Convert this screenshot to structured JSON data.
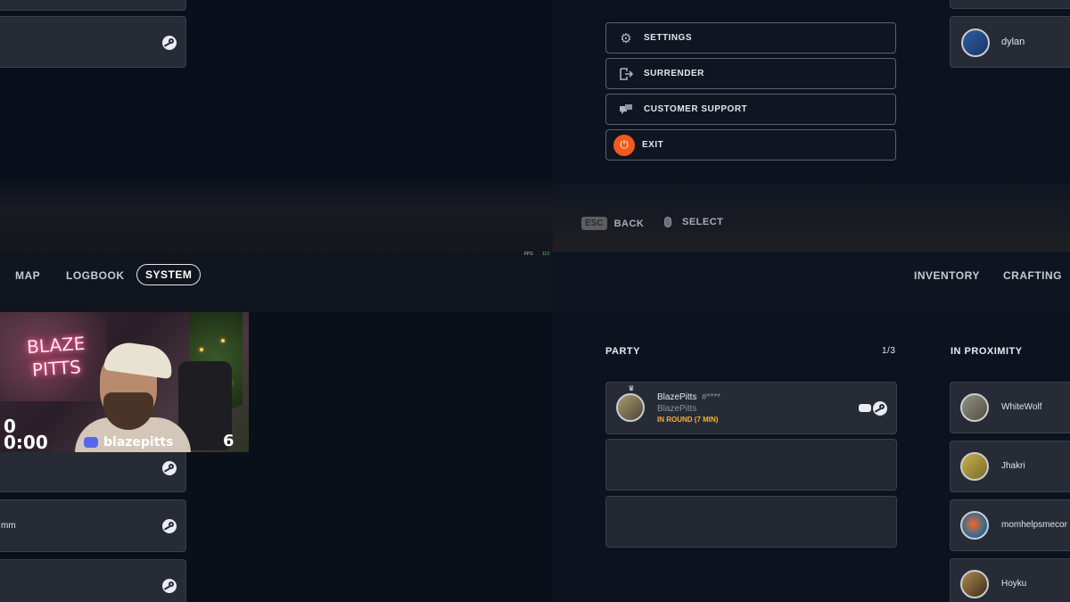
{
  "system_menu": {
    "settings_label": "SETTINGS",
    "surrender_label": "SURRENDER",
    "customer_support_label": "CUSTOMER SUPPORT",
    "exit_label": "EXIT"
  },
  "hints": {
    "back_key": "ESC",
    "back_label": "BACK",
    "select_label": "SELECT"
  },
  "fps": {
    "label": "FPS",
    "value": "113"
  },
  "nav_left": {
    "map": "MAP",
    "logbook": "LOGBOOK",
    "system": "SYSTEM"
  },
  "nav_right": {
    "inventory": "INVENTORY",
    "crafting": "CRAFTING"
  },
  "top_right_player": {
    "name": "dylan"
  },
  "party": {
    "title": "PARTY",
    "count": "1/3",
    "member": {
      "name": "BlazePitts",
      "tag": "#****",
      "subname": "BlazePitts",
      "status": "IN ROUND (7 MIN)"
    }
  },
  "proximity": {
    "title": "IN PROXIMITY",
    "players": [
      {
        "name": "WhiteWolf"
      },
      {
        "name": "Jhakri"
      },
      {
        "name": "momhelpsmecor"
      },
      {
        "name": "Hoyku"
      }
    ]
  },
  "left_list": {
    "partial_name": "mm"
  },
  "webcam": {
    "neon_line1": "BLAZE",
    "neon_line2": "PITTS",
    "score_top": "0",
    "timer": "0:00",
    "channel": "blazepitts",
    "count": "6"
  },
  "colors": {
    "accent_orange": "#f05a1c",
    "status_yellow": "#f2b231",
    "card_bg": "#262b36"
  }
}
